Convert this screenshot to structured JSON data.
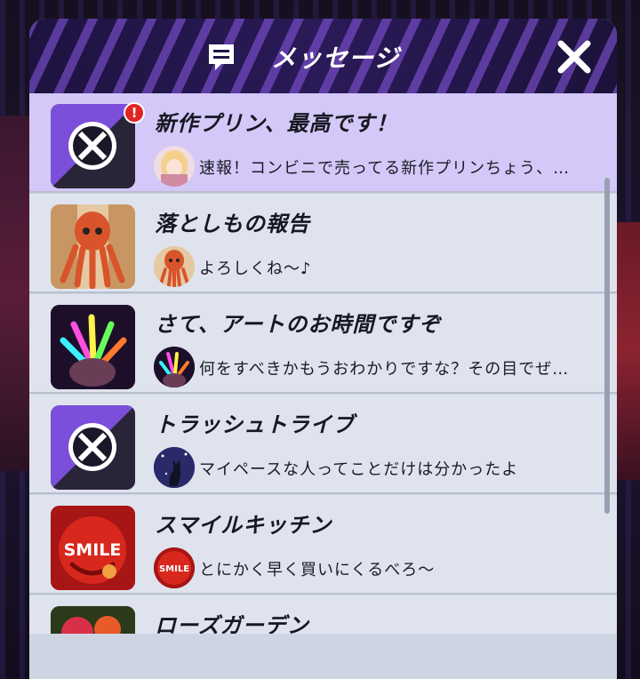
{
  "header": {
    "title": "メッセージ",
    "icon": "message-icon",
    "close_icon": "close-icon"
  },
  "colors": {
    "unread_row": "#d3c8f7",
    "read_row": "#dfe3ee",
    "header_bg": "#1d1340",
    "badge": "#e02525"
  },
  "messages": [
    {
      "title": "新作プリン、最高です！",
      "preview": "速報！コンビニで売ってる新作プリンちょう、…",
      "unread": true,
      "badge": "!",
      "icon": "trash-tribe-logo",
      "avatar": "blonde-girl-avatar"
    },
    {
      "title": "落としもの報告",
      "preview": "よろしくね～♪",
      "unread": false,
      "icon": "octopus-mascot",
      "avatar": "octopus-mascot-avatar"
    },
    {
      "title": "さて、アートのお時間ですぞ",
      "preview": "何をすべきかもうおわかりですな？その目でぜ…",
      "unread": false,
      "icon": "neon-glowsticks",
      "avatar": "neon-glowsticks-avatar"
    },
    {
      "title": "トラッシュトライブ",
      "preview": "マイペースな人ってことだけは分かったよ",
      "unread": false,
      "icon": "trash-tribe-logo",
      "avatar": "night-cat-avatar"
    },
    {
      "title": "スマイルキッチン",
      "preview": "とにかく早く買いにくるべろ～",
      "unread": false,
      "icon": "smile-kitchen-logo",
      "avatar": "smile-kitchen-avatar",
      "logo_text": "SMILE"
    },
    {
      "title": "ローズガーデン",
      "preview": "",
      "unread": false,
      "icon": "rose-garden-logo"
    }
  ]
}
